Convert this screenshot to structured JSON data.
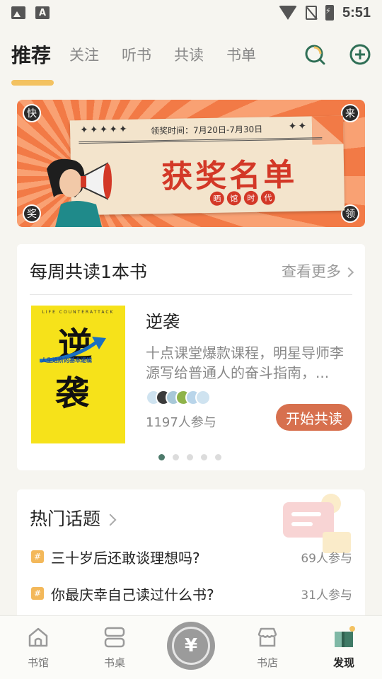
{
  "status_bar": {
    "time": "5:51",
    "icons": [
      "image-icon",
      "font-icon",
      "wifi-icon",
      "no-sim-icon",
      "battery-charging-icon"
    ]
  },
  "tabs": {
    "items": [
      {
        "label": "推荐",
        "active": true
      },
      {
        "label": "关注",
        "active": false
      },
      {
        "label": "听书",
        "active": false
      },
      {
        "label": "共读",
        "active": false
      },
      {
        "label": "书单",
        "active": false
      }
    ],
    "icons": [
      "search-icon",
      "add-circle-icon"
    ],
    "accent_color": "#f3c261"
  },
  "banner": {
    "award_time": "领奖时间：7月20日-7月30日",
    "stars": "✦✦✦✦✦",
    "stars_right": "✦✦",
    "title": "获奖名单",
    "tags": [
      "晒",
      "馆",
      "时",
      "代"
    ],
    "corners": {
      "tl": "快",
      "tr": "来",
      "bl": "奖",
      "br": "领"
    }
  },
  "weekly": {
    "title": "每周共读1本书",
    "more": "查看更多",
    "book": {
      "cover_top": "LIFE COUNTERATTACK",
      "cover_char1": "逆",
      "cover_char2": "袭",
      "cover_sub": "人生进阶的基本逻辑",
      "title": "逆袭",
      "description": "十点课堂爆款课程，明星导师李源写给普通人的奋斗指南，...",
      "participants": "1197人参与",
      "action": "开始共读"
    },
    "avatar_colors": [
      "#cfe3f0",
      "#3b3b3b",
      "#a8c8d8",
      "#8fb34a",
      "#b9d5ea",
      "#cfe3f0"
    ],
    "pagination": {
      "current": 1,
      "total": 5
    },
    "action_color": "#d7704e"
  },
  "hot_topics": {
    "title": "热门话题",
    "items": [
      {
        "text": "三十岁后还敢谈理想吗?",
        "count": "69人参与"
      },
      {
        "text": "你最庆幸自己读过什么书?",
        "count": "31人参与"
      }
    ]
  },
  "bottom_nav": {
    "items": [
      {
        "label": "书馆",
        "icon": "home-icon",
        "active": false
      },
      {
        "label": "书桌",
        "icon": "desk-icon",
        "active": false
      },
      {
        "label": "",
        "icon": "yuan-coin-icon",
        "active": false
      },
      {
        "label": "书店",
        "icon": "store-icon",
        "active": false
      },
      {
        "label": "发现",
        "icon": "discover-icon",
        "active": true
      }
    ],
    "center_symbol": "¥"
  }
}
